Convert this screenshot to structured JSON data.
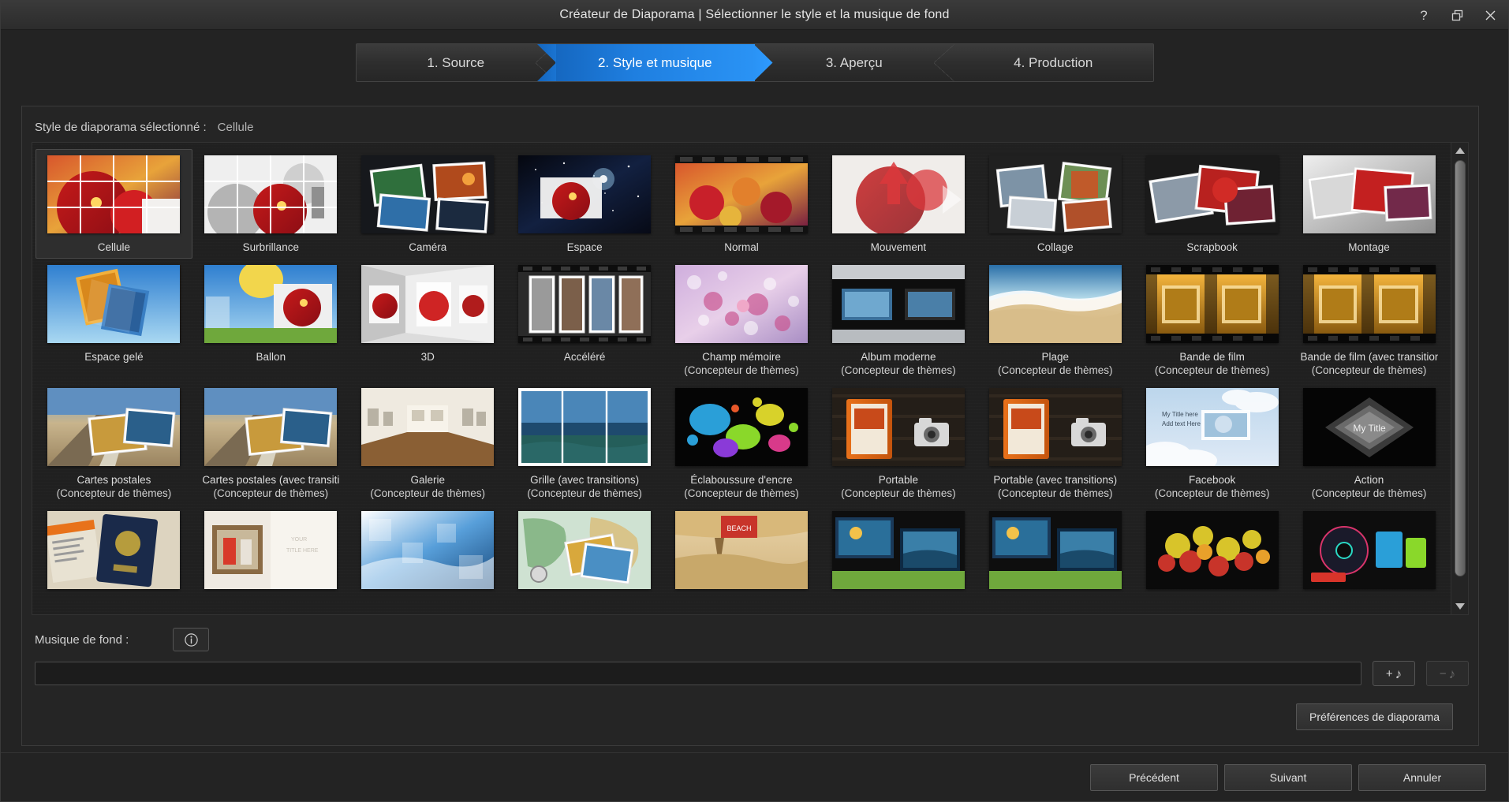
{
  "window": {
    "title": "Créateur de Diaporama | Sélectionner le style et la musique de fond",
    "help_icon": "question-mark-icon",
    "restore_icon": "restore-window-icon",
    "close_icon": "close-icon"
  },
  "steps": [
    {
      "label": "1. Source",
      "active": false
    },
    {
      "label": "2. Style et musique",
      "active": true
    },
    {
      "label": "3. Aperçu",
      "active": false
    },
    {
      "label": "4. Production",
      "active": false
    }
  ],
  "selection": {
    "label": "Style de diaporama sélectionné :",
    "value": "Cellule"
  },
  "styles": [
    {
      "name": "Cellule",
      "sub": "",
      "selected": true,
      "art": "cellule"
    },
    {
      "name": "Surbrillance",
      "sub": "",
      "selected": false,
      "art": "surbrillance"
    },
    {
      "name": "Caméra",
      "sub": "",
      "selected": false,
      "art": "camera"
    },
    {
      "name": "Espace",
      "sub": "",
      "selected": false,
      "art": "espace"
    },
    {
      "name": "Normal",
      "sub": "",
      "selected": false,
      "art": "normal"
    },
    {
      "name": "Mouvement",
      "sub": "",
      "selected": false,
      "art": "mouvement"
    },
    {
      "name": "Collage",
      "sub": "",
      "selected": false,
      "art": "collage"
    },
    {
      "name": "Scrapbook",
      "sub": "",
      "selected": false,
      "art": "scrapbook"
    },
    {
      "name": "Montage",
      "sub": "",
      "selected": false,
      "art": "montage"
    },
    {
      "name": "Espace gelé",
      "sub": "",
      "selected": false,
      "art": "espacegele"
    },
    {
      "name": "Ballon",
      "sub": "",
      "selected": false,
      "art": "ballon"
    },
    {
      "name": "3D",
      "sub": "",
      "selected": false,
      "art": "threed"
    },
    {
      "name": "Accéléré",
      "sub": "",
      "selected": false,
      "art": "accelere"
    },
    {
      "name": "Champ mémoire",
      "sub": "(Concepteur de thèmes)",
      "selected": false,
      "art": "champmemoire"
    },
    {
      "name": "Album moderne",
      "sub": "(Concepteur de thèmes)",
      "selected": false,
      "art": "albummoderne"
    },
    {
      "name": "Plage",
      "sub": "(Concepteur de thèmes)",
      "selected": false,
      "art": "plage"
    },
    {
      "name": "Bande de film",
      "sub": "(Concepteur de thèmes)",
      "selected": false,
      "art": "bandedefilm"
    },
    {
      "name": "Bande de film (avec transitions)",
      "sub": "(Concepteur de thèmes)",
      "selected": false,
      "art": "bandedefilmt"
    },
    {
      "name": "Cartes postales",
      "sub": "(Concepteur de thèmes)",
      "selected": false,
      "art": "cartespostales"
    },
    {
      "name": "Cartes postales (avec transitions)",
      "sub": "(Concepteur de thèmes)",
      "selected": false,
      "art": "cartespostalest"
    },
    {
      "name": "Galerie",
      "sub": "(Concepteur de thèmes)",
      "selected": false,
      "art": "galerie"
    },
    {
      "name": "Grille (avec transitions)",
      "sub": "(Concepteur de thèmes)",
      "selected": false,
      "art": "grille"
    },
    {
      "name": "Éclaboussure d'encre",
      "sub": "(Concepteur de thèmes)",
      "selected": false,
      "art": "eclaboussure"
    },
    {
      "name": "Portable",
      "sub": "(Concepteur de thèmes)",
      "selected": false,
      "art": "portable"
    },
    {
      "name": "Portable (avec transitions)",
      "sub": "(Concepteur de thèmes)",
      "selected": false,
      "art": "portablet"
    },
    {
      "name": "Facebook",
      "sub": "(Concepteur de thèmes)",
      "selected": false,
      "art": "facebook"
    },
    {
      "name": "Action",
      "sub": "(Concepteur de thèmes)",
      "selected": false,
      "art": "action"
    },
    {
      "name": "",
      "sub": "",
      "selected": false,
      "art": "passport"
    },
    {
      "name": "",
      "sub": "",
      "selected": false,
      "art": "window"
    },
    {
      "name": "",
      "sub": "",
      "selected": false,
      "art": "blue"
    },
    {
      "name": "",
      "sub": "",
      "selected": false,
      "art": "map"
    },
    {
      "name": "",
      "sub": "",
      "selected": false,
      "art": "beach2"
    },
    {
      "name": "",
      "sub": "",
      "selected": false,
      "art": "sunset"
    },
    {
      "name": "",
      "sub": "",
      "selected": false,
      "art": "sunset2"
    },
    {
      "name": "",
      "sub": "",
      "selected": false,
      "art": "flowers"
    },
    {
      "name": "",
      "sub": "",
      "selected": false,
      "art": "disc"
    }
  ],
  "facebook_thumb_text": {
    "title": "My Title here",
    "body": "Add text Here"
  },
  "action_thumb_text": {
    "title": "My Title"
  },
  "music": {
    "label": "Musique de fond :",
    "info_icon": "info-icon",
    "input_value": "",
    "input_placeholder": "",
    "add_label": "+",
    "add_icon": "music-note-icon",
    "remove_label": "−",
    "remove_icon": "music-note-icon"
  },
  "preferences_button": "Préférences de diaporama",
  "footer": {
    "previous": "Précédent",
    "next": "Suivant",
    "cancel": "Annuler"
  },
  "scrollbar": {
    "up_icon": "chevron-up-icon",
    "down_icon": "chevron-down-icon"
  },
  "colors": {
    "accent": "#2a93f5",
    "accent_dark": "#1567c0",
    "panel": "#252525",
    "window": "#232323",
    "text": "#d8d8d8"
  }
}
